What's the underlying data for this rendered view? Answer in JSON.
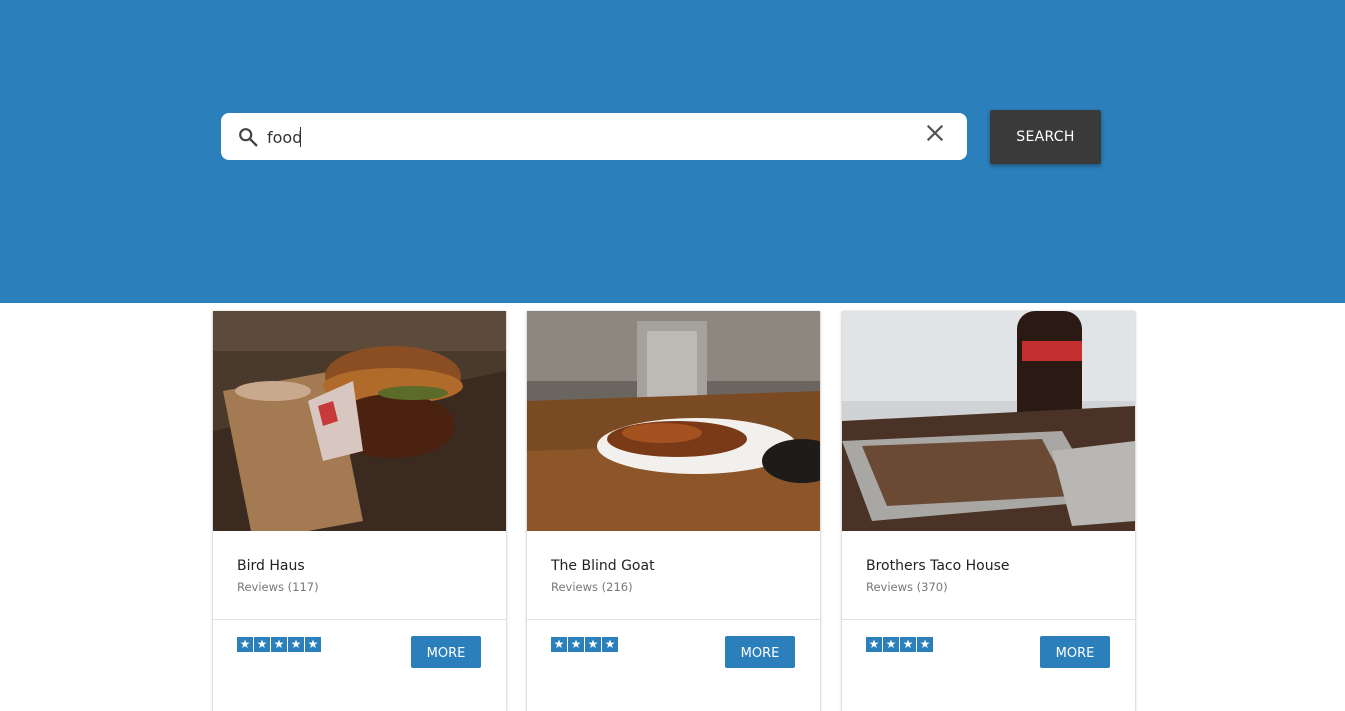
{
  "search": {
    "value": "food",
    "button_label": "SEARCH"
  },
  "colors": {
    "hero_bg": "#2b7fbb",
    "accent": "#2b7fbb",
    "search_button_bg": "#3a3a3a"
  },
  "icons": {
    "search": "search-icon",
    "clear": "close-icon",
    "star": "star-icon"
  },
  "results": [
    {
      "name": "Bird Haus",
      "reviews": "Reviews (117)",
      "rating": 5,
      "more_label": "MORE"
    },
    {
      "name": "The Blind Goat",
      "reviews": "Reviews (216)",
      "rating": 4,
      "more_label": "MORE"
    },
    {
      "name": "Brothers Taco House",
      "reviews": "Reviews (370)",
      "rating": 4,
      "more_label": "MORE"
    }
  ]
}
